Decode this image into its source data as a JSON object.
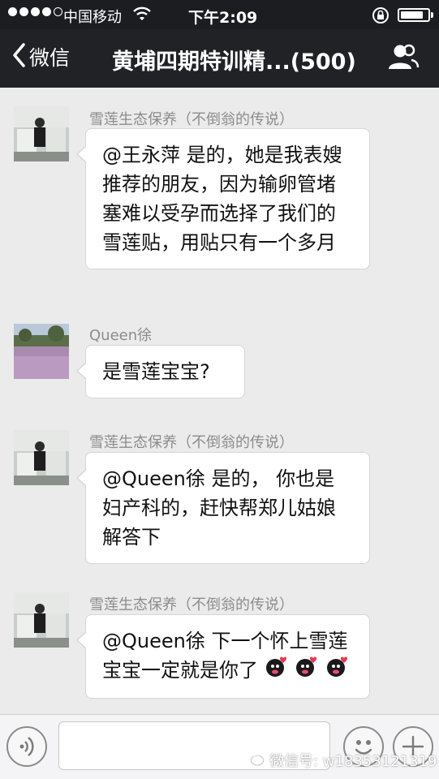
{
  "status_bar": {
    "carrier": "中国移动",
    "time": "下午2:09",
    "signal_bars_filled": 4,
    "signal_bars_total": 5,
    "battery_level_percent": 85
  },
  "nav": {
    "back_label": "微信",
    "title": "黄埔四期特训精...(500)",
    "back_icon": "chevron-left-icon",
    "contacts_icon": "group-members-icon"
  },
  "messages": [
    {
      "sender": "雪莲生态保养（不倒翁的传说）",
      "avatar": "avatar-man-in-white-room",
      "text": "@王永萍 是的，她是我表嫂推荐的朋友，因为输卵管堵塞难以受孕而选择了我们的雪莲贴，用贴只有一个多月"
    },
    {
      "sender": "Queen徐",
      "avatar": "avatar-lavender-field",
      "text": "是雪莲宝宝?"
    },
    {
      "sender": "雪莲生态保养（不倒翁的传说）",
      "avatar": "avatar-man-in-white-room",
      "text": "@Queen徐 是的， 你也是妇产科的，赶快帮郑儿姑娘解答下"
    },
    {
      "sender": "雪莲生态保养（不倒翁的传说）",
      "avatar": "avatar-man-in-white-room",
      "text": "@Queen徐 下一个怀上雪莲宝宝一定就是你了",
      "emoji": [
        "kiss-emoji",
        "kiss-emoji",
        "kiss-emoji"
      ]
    }
  ],
  "input_bar": {
    "voice_icon": "voice-icon",
    "emoji_icon": "smiley-icon",
    "plus_icon": "plus-icon"
  },
  "watermark": {
    "text": "微信号: w18353121319",
    "icon": "wechat-logo-icon"
  },
  "colors": {
    "bar_bg": "#212226",
    "chat_bg": "#ebebeb",
    "bubble_bg": "#ffffff",
    "sender_text": "#8c8c8c"
  }
}
